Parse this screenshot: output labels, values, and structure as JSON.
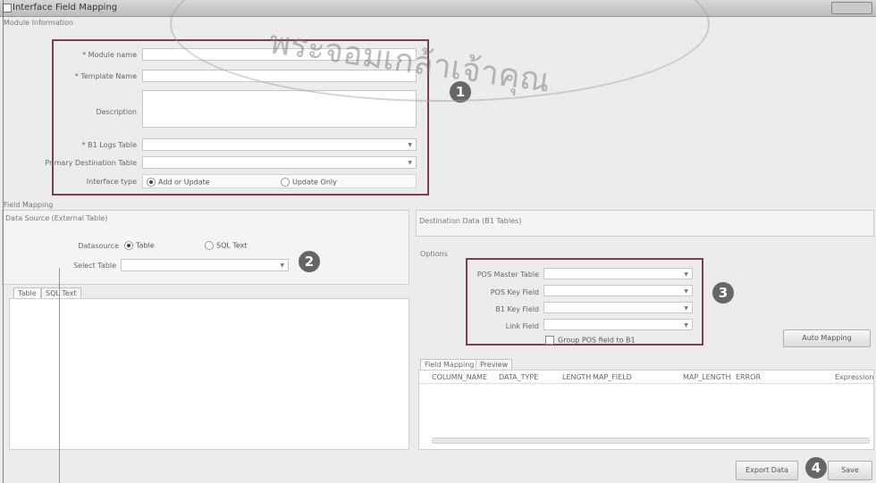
{
  "window": {
    "title": "Interface Field Mapping"
  },
  "module_section": {
    "label": "Module Information",
    "module_name_label": "* Module name",
    "template_name_label": "* Template Name",
    "description_label": "Description",
    "b1_logs_table_label": "* B1 Logs Table",
    "primary_destination_label": "Primary Destination Table",
    "interface_type_label": "Interface type",
    "radio_add_or_update": "Add or Update",
    "radio_update_only": "Update Only"
  },
  "field_mapping_label": "Field Mapping",
  "source": {
    "title": "Data Source (External Table)",
    "datasource_label": "Datasource",
    "radio_table": "Table",
    "radio_sql": "SQL Text",
    "select_table_label": "Select Table",
    "tabs": [
      "Table",
      "SQL Text"
    ]
  },
  "destination": {
    "title": "Destination Data (B1 Tables)",
    "options_label": "Options",
    "pos_master_label": "POS Master Table",
    "pos_key_label": "POS Key Field",
    "b1_key_label": "B1 Key Field",
    "link_field_label": "Link Field",
    "group_pos_label": "Group POS field to B1",
    "auto_mapping_button": "Auto Mapping",
    "tabs": [
      "Field Mapping",
      "Preview"
    ],
    "columns": [
      "COLUMN_NAME",
      "DATA_TYPE",
      "LENGTH",
      "MAP_FIELD",
      "MAP_LENGTH",
      "ERROR",
      "Expression"
    ]
  },
  "footer": {
    "export_button": "Export Data",
    "save_button": "Save"
  },
  "badges": [
    "1",
    "2",
    "3",
    "4"
  ],
  "watermark_text": "พระจอมเกล้าเจ้าคุณ",
  "colors": {
    "highlight_box": "#7a3f57",
    "badge": "#666666"
  }
}
